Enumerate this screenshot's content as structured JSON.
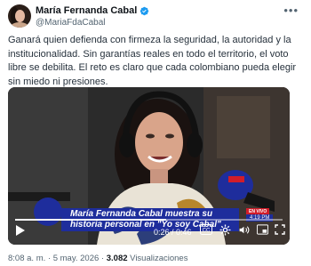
{
  "author": {
    "name": "María Fernanda Cabal",
    "handle": "@MariaFdaCabal"
  },
  "icons": {
    "verified": "verified-badge-icon",
    "more": "more-options-icon",
    "play": "play-icon",
    "captions": "captions-icon",
    "settings": "settings-gear-icon",
    "volume": "volume-icon",
    "pip": "picture-in-picture-icon",
    "fullscreen": "fullscreen-icon"
  },
  "tweet": {
    "text": "Ganará quien defienda con firmeza la seguridad, la autoridad y la institucionalidad. Sin garantías reales en todo el territorio, el voto libre se debilita. El reto es claro que cada colombiano pueda elegir sin miedo ni presiones."
  },
  "video": {
    "banner_line1": "María Fernanda Cabal muestra su",
    "banner_line2": "historia personal en \"Yo soy Cabal\"",
    "live_badge": "EN VIVO",
    "clock": "4:19 PM",
    "time_display": "0:26 / 0:46",
    "progress": 0.565
  },
  "meta": {
    "time": "8:08 a. m.",
    "separator1": "·",
    "date": "5 may. 2026",
    "separator2": "·",
    "views_count": "3.082",
    "views_label": "Visualizaciones"
  },
  "colors": {
    "verified": "#1d9bf0",
    "banner": "#1e2d9c",
    "live": "#d11d2a"
  }
}
